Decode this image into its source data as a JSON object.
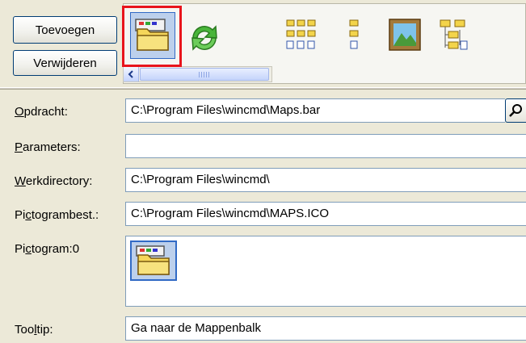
{
  "buttons": {
    "add_label": "Toevoegen",
    "remove_label": "Verwijderen"
  },
  "toolbar_icons": [
    "mappenbalk-icon",
    "refresh-icon",
    "brief-view-icon",
    "list-view-icon",
    "thumbnail-view-icon",
    "tree-view-icon"
  ],
  "form": {
    "command": {
      "prefix": "",
      "accel": "O",
      "rest": "pdracht:",
      "value": "C:\\Program Files\\wincmd\\Maps.bar"
    },
    "parameters": {
      "prefix": "",
      "accel": "P",
      "rest": "arameters:",
      "value": ""
    },
    "workdir": {
      "prefix": "",
      "accel": "W",
      "rest": "erkdirectory:",
      "value": "C:\\Program Files\\wincmd\\"
    },
    "iconfile": {
      "prefix": "Pi",
      "accel": "c",
      "rest": "togrambest.:",
      "value": "C:\\Program Files\\wincmd\\MAPS.ICO"
    },
    "icon": {
      "prefix": "Pi",
      "accel": "c",
      "rest": "togram:0"
    },
    "tooltip": {
      "prefix": "Too",
      "accel": "l",
      "rest": "tip:",
      "value": "Ga naar de Mappenbalk"
    }
  },
  "colors": {
    "highlight": "#e8141c",
    "window_bg": "#ece9d8",
    "field_border": "#7f9db9"
  }
}
